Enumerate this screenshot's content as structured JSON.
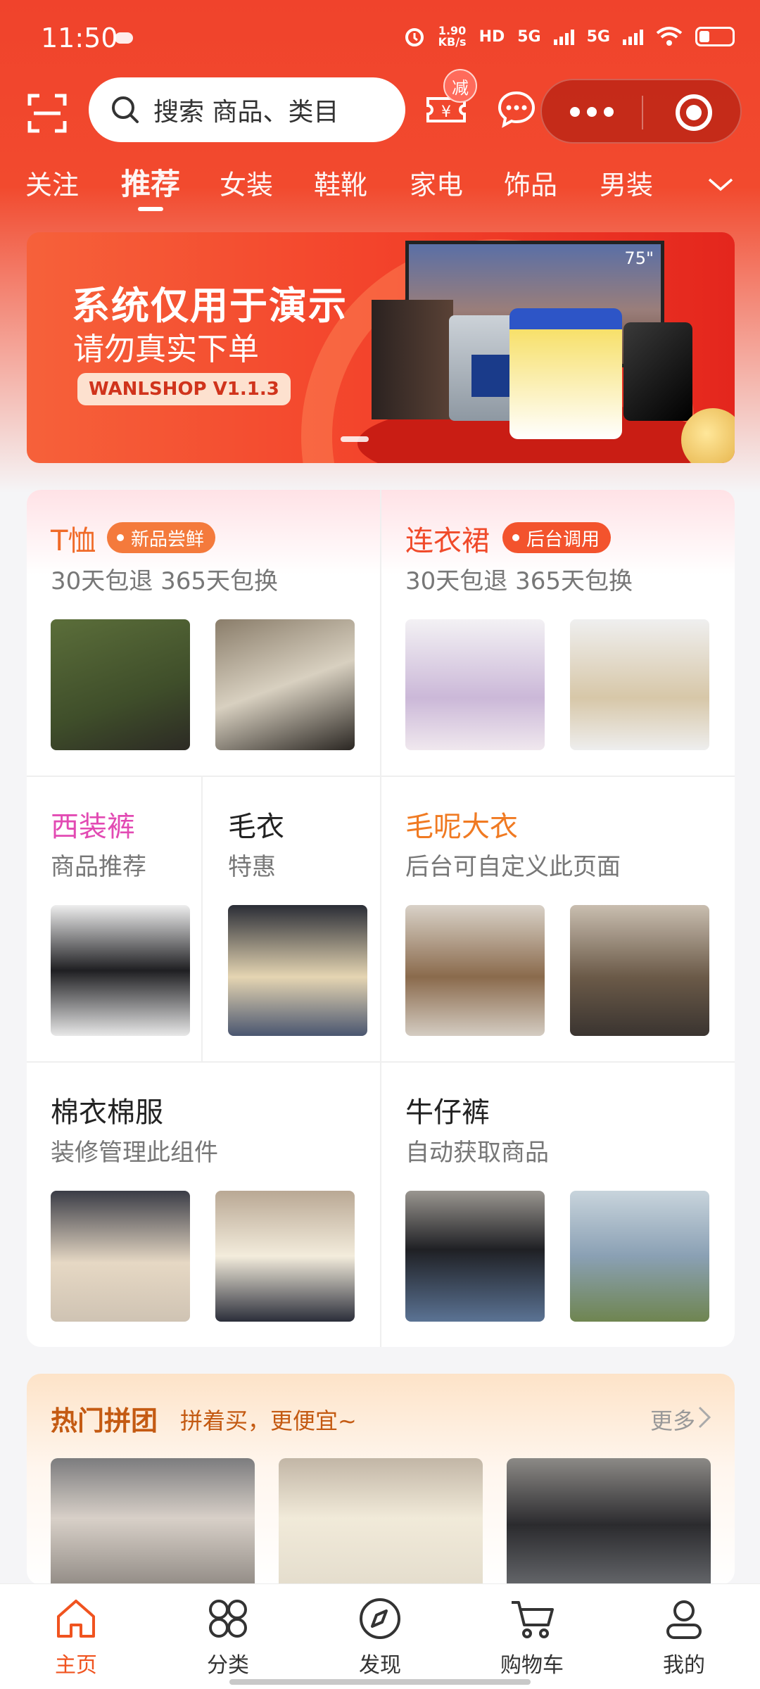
{
  "status_bar": {
    "time": "11:50",
    "net_speed": "1.90",
    "net_unit": "KB/s",
    "hd": "HD",
    "sig1": "5G",
    "sig2": "5G"
  },
  "search": {
    "placeholder": "搜索 商品、类目"
  },
  "coupon_badge": "减",
  "tabs": [
    "关注",
    "推荐",
    "女装",
    "鞋靴",
    "家电",
    "饰品",
    "男装"
  ],
  "banner": {
    "line1": "系统仅用于演示",
    "line2": "请勿真实下单",
    "pill": "WANLSHOP V1.1.3",
    "tv_size": "75\""
  },
  "categories": [
    {
      "title": "T恤",
      "subtitle": "30天包退 365天包换",
      "tag": "新品尝鲜",
      "title_color": "#f06a28",
      "tag_color": "#f47a3c"
    },
    {
      "title": "连衣裙",
      "subtitle": "30天包退 365天包换",
      "tag": "后台调用",
      "title_color": "#f04a2a",
      "tag_color": "#f3532d"
    },
    {
      "title": "西装裤",
      "subtitle": "商品推荐",
      "title_color": "#e24ab3"
    },
    {
      "title": "毛衣",
      "subtitle": "特惠",
      "title_color": "#222222"
    },
    {
      "title": "毛呢大衣",
      "subtitle": "后台可自定义此页面",
      "title_color": "#f07a22"
    },
    {
      "title": "棉衣棉服",
      "subtitle": "装修管理此组件",
      "title_color": "#222222"
    },
    {
      "title": "牛仔裤",
      "subtitle": "自动获取商品",
      "title_color": "#222222"
    }
  ],
  "group_buy": {
    "title": "热门拼团",
    "subtitle": "拼着买，更便宜~",
    "more": "更多"
  },
  "bottom_nav": [
    {
      "label": "主页",
      "icon": "home-icon",
      "active": true
    },
    {
      "label": "分类",
      "icon": "category-icon",
      "active": false
    },
    {
      "label": "发现",
      "icon": "compass-icon",
      "active": false
    },
    {
      "label": "购物车",
      "icon": "cart-icon",
      "active": false
    },
    {
      "label": "我的",
      "icon": "user-icon",
      "active": false
    }
  ],
  "colors": {
    "primary": "#f0432c",
    "accent": "#f0531f",
    "group_title": "#c45a12"
  }
}
